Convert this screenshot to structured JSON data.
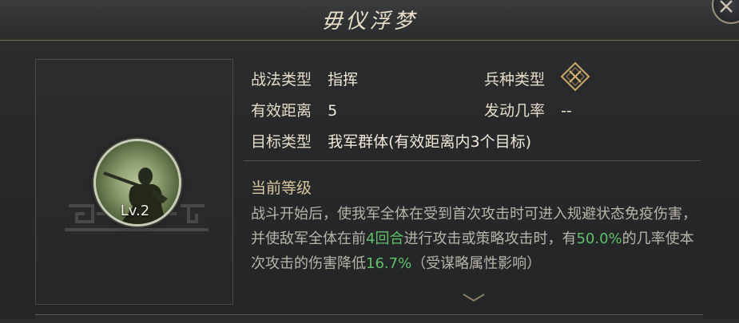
{
  "header": {
    "title": "毋仪浮梦"
  },
  "skill": {
    "level": "Lv.2"
  },
  "info": {
    "tactic_type_label": "战法类型",
    "tactic_type_value": "指挥",
    "troop_type_label": "兵种类型",
    "range_label": "有效距离",
    "range_value": "5",
    "trigger_rate_label": "发动几率",
    "trigger_rate_value": "--",
    "target_type_label": "目标类型",
    "target_type_value": "我军群体(有效距离内3个目标)"
  },
  "current_level": {
    "title": "当前等级",
    "desc": {
      "p1": "战斗开始后，使我军全体在受到首次攻击时可进入规避状态免疫伤害，并使敌军全体在前",
      "rounds": "4回合",
      "p2": "进行攻击或策略攻击时，有",
      "chance": "50.0%",
      "p3": "的几率使本次攻击的伤害降低",
      "reduction": "16.7%",
      "p4": "（受谋略属性影响）"
    }
  },
  "colors": {
    "highlight": "#5fc16a",
    "accent_gold": "#d8c6a0"
  },
  "icons": {
    "troop_type": "troop-type-diamond-icon",
    "close": "close-x-icon",
    "scroll": "chevron-down-icon"
  }
}
